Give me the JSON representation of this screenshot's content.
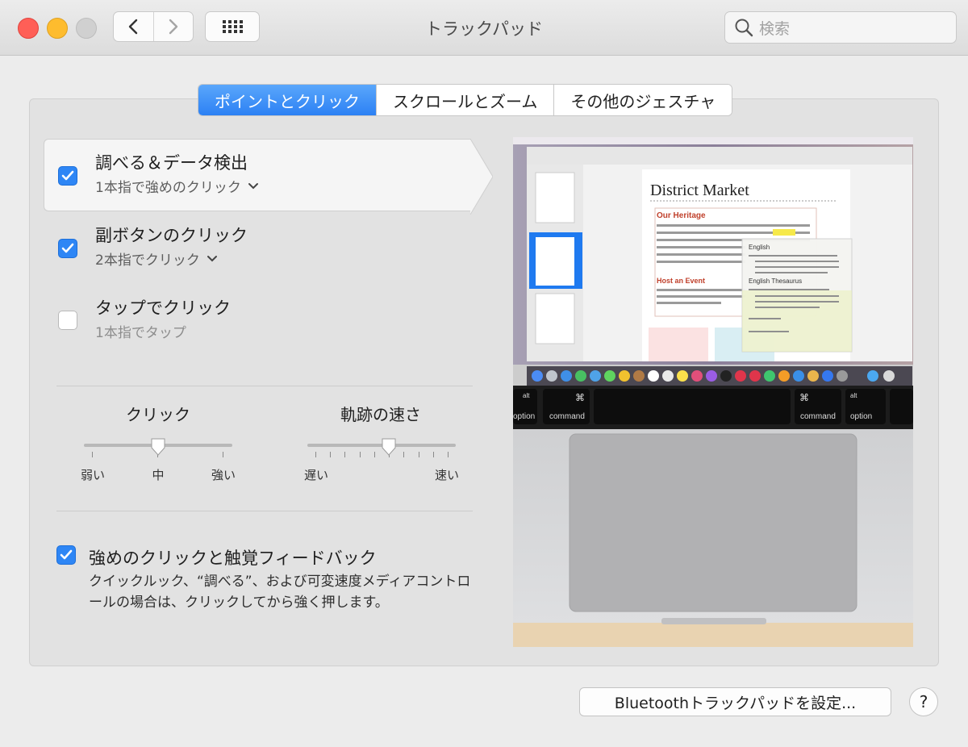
{
  "window": {
    "title": "トラックパッド"
  },
  "toolbar": {
    "search_placeholder": "検索"
  },
  "tabs": [
    {
      "label": "ポイントとクリック",
      "active": true
    },
    {
      "label": "スクロールとズーム",
      "active": false
    },
    {
      "label": "その他のジェスチャ",
      "active": false
    }
  ],
  "options": [
    {
      "label": "調べる＆データ検出",
      "sub": "1本指で強めのクリック",
      "checked": true
    },
    {
      "label": "副ボタンのクリック",
      "sub": "2本指でクリック",
      "checked": true
    },
    {
      "label": "タップでクリック",
      "sub": "1本指でタップ",
      "checked": false
    }
  ],
  "sliders": {
    "click": {
      "title": "クリック",
      "labels": [
        "弱い",
        "中",
        "強い"
      ],
      "value": "中"
    },
    "speed": {
      "title": "軌跡の速さ",
      "labels": [
        "遅い",
        "速い"
      ],
      "value_fraction": 0.55
    }
  },
  "force_click": {
    "label": "強めのクリックと触覚フィードバック",
    "checked": true,
    "description": "クイックルック、“調べる”、および可変速度メディアコントロールの場合は、クリックしてから強く押します。"
  },
  "preview": {
    "doc_title": "District Market",
    "heading1": "Our Heritage",
    "heading2": "Host an Event",
    "popup_lang": "English",
    "popup_thesaurus": "English Thesaurus",
    "key_left": "option",
    "key_cmd": "command",
    "key_alt": "alt"
  },
  "footer": {
    "bluetooth_button": "Bluetoothトラックパッドを設定...",
    "help": "?"
  }
}
